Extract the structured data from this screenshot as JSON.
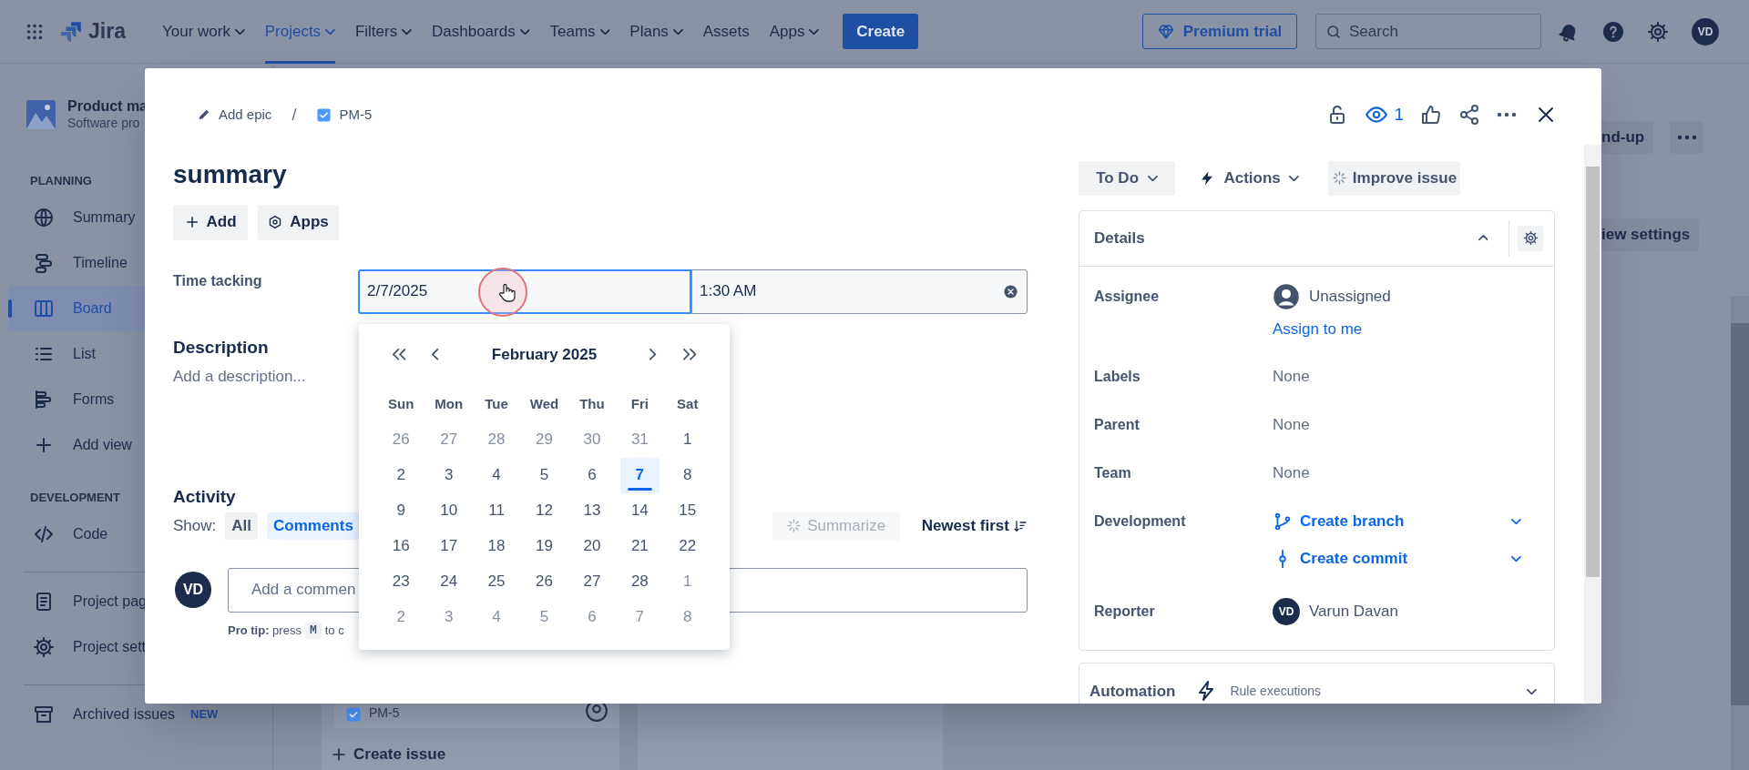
{
  "top_nav": {
    "product": "Jira",
    "items": [
      {
        "label": "Your work",
        "dropdown": true,
        "selected": false
      },
      {
        "label": "Projects",
        "dropdown": true,
        "selected": true
      },
      {
        "label": "Filters",
        "dropdown": true,
        "selected": false
      },
      {
        "label": "Dashboards",
        "dropdown": true,
        "selected": false
      },
      {
        "label": "Teams",
        "dropdown": true,
        "selected": false
      },
      {
        "label": "Plans",
        "dropdown": true,
        "selected": false
      },
      {
        "label": "Assets",
        "dropdown": false,
        "selected": false
      },
      {
        "label": "Apps",
        "dropdown": true,
        "selected": false
      }
    ],
    "create_button": "Create",
    "premium_button": "Premium trial",
    "search": {
      "placeholder": "Search"
    },
    "avatar": "VD"
  },
  "sidebar": {
    "project": {
      "name": "Product ma",
      "type": "Software pro"
    },
    "groups": [
      {
        "heading": "PLANNING",
        "items": [
          {
            "label": "Summary",
            "selected": false
          },
          {
            "label": "Timeline",
            "selected": false
          },
          {
            "label": "Board",
            "selected": true
          },
          {
            "label": "List",
            "selected": false
          },
          {
            "label": "Forms",
            "selected": false
          },
          {
            "label": "Add view",
            "selected": false
          }
        ]
      },
      {
        "heading": "DEVELOPMENT",
        "items": [
          {
            "label": "Code",
            "selected": false
          }
        ]
      },
      {
        "items": [
          {
            "label": "Project pag",
            "selected": false
          },
          {
            "label": "Project sett",
            "selected": false
          }
        ]
      },
      {
        "items": [
          {
            "label": "Archived issues",
            "badge": "NEW",
            "selected": false
          }
        ]
      }
    ]
  },
  "board": {
    "header_button": "nd-up",
    "view_settings": "iew settings",
    "card": {
      "key": "PM-5"
    },
    "create_issue": "Create issue"
  },
  "issue_modal": {
    "breadcrumb": {
      "epic": "Add epic",
      "separator": "/",
      "issue_key": "PM-5"
    },
    "watch_count": "1",
    "title": "summary",
    "quick_buttons": [
      "Add",
      "Apps"
    ],
    "time_tracking": {
      "label": "Time tacking",
      "date": "2/7/2025",
      "time": "1:30 AM"
    },
    "calendar": {
      "month": "February 2025",
      "weekdays": [
        "Sun",
        "Mon",
        "Tue",
        "Wed",
        "Thu",
        "Fri",
        "Sat"
      ],
      "weeks": [
        [
          {
            "day": "26",
            "outside": true,
            "selected": false
          },
          {
            "day": "27",
            "outside": true,
            "selected": false
          },
          {
            "day": "28",
            "outside": true,
            "selected": false
          },
          {
            "day": "29",
            "outside": true,
            "selected": false
          },
          {
            "day": "30",
            "outside": true,
            "selected": false
          },
          {
            "day": "31",
            "outside": true,
            "selected": false
          },
          {
            "day": "1",
            "outside": false,
            "selected": false
          }
        ],
        [
          {
            "day": "2",
            "outside": false,
            "selected": false
          },
          {
            "day": "3",
            "outside": false,
            "selected": false
          },
          {
            "day": "4",
            "outside": false,
            "selected": false
          },
          {
            "day": "5",
            "outside": false,
            "selected": false
          },
          {
            "day": "6",
            "outside": false,
            "selected": false
          },
          {
            "day": "7",
            "outside": false,
            "selected": true
          },
          {
            "day": "8",
            "outside": false,
            "selected": false
          }
        ],
        [
          {
            "day": "9",
            "outside": false,
            "selected": false
          },
          {
            "day": "10",
            "outside": false,
            "selected": false
          },
          {
            "day": "11",
            "outside": false,
            "selected": false
          },
          {
            "day": "12",
            "outside": false,
            "selected": false
          },
          {
            "day": "13",
            "outside": false,
            "selected": false
          },
          {
            "day": "14",
            "outside": false,
            "selected": false
          },
          {
            "day": "15",
            "outside": false,
            "selected": false
          }
        ],
        [
          {
            "day": "16",
            "outside": false,
            "selected": false
          },
          {
            "day": "17",
            "outside": false,
            "selected": false
          },
          {
            "day": "18",
            "outside": false,
            "selected": false
          },
          {
            "day": "19",
            "outside": false,
            "selected": false
          },
          {
            "day": "20",
            "outside": false,
            "selected": false
          },
          {
            "day": "21",
            "outside": false,
            "selected": false
          },
          {
            "day": "22",
            "outside": false,
            "selected": false
          }
        ],
        [
          {
            "day": "23",
            "outside": false,
            "selected": false
          },
          {
            "day": "24",
            "outside": false,
            "selected": false
          },
          {
            "day": "25",
            "outside": false,
            "selected": false
          },
          {
            "day": "26",
            "outside": false,
            "selected": false
          },
          {
            "day": "27",
            "outside": false,
            "selected": false
          },
          {
            "day": "28",
            "outside": false,
            "selected": false
          },
          {
            "day": "1",
            "outside": true,
            "selected": false
          }
        ],
        [
          {
            "day": "2",
            "outside": true,
            "selected": false
          },
          {
            "day": "3",
            "outside": true,
            "selected": false
          },
          {
            "day": "4",
            "outside": true,
            "selected": false
          },
          {
            "day": "5",
            "outside": true,
            "selected": false
          },
          {
            "day": "6",
            "outside": true,
            "selected": false
          },
          {
            "day": "7",
            "outside": true,
            "selected": false
          },
          {
            "day": "8",
            "outside": true,
            "selected": false
          }
        ]
      ]
    },
    "description": {
      "heading": "Description",
      "placeholder": "Add a description..."
    },
    "activity": {
      "heading": "Activity",
      "show_label": "Show:",
      "filters": [
        {
          "label": "All",
          "selected": false
        },
        {
          "label": "Comments",
          "selected": true
        }
      ],
      "summarize": {
        "label": "Summarize",
        "disabled": true
      },
      "sort": "Newest first",
      "comment": {
        "avatar": "VD",
        "placeholder": "Add a commen"
      },
      "pro_tip": {
        "lead": "**Pro tip:** press",
        "key": "M",
        "rest": "to c"
      }
    },
    "status_button": "To Do",
    "actions_button": "Actions",
    "improve_button": "Improve issue",
    "details": {
      "heading": "Details",
      "expanded": true,
      "fields": [
        {
          "label": "Assignee",
          "kind": "user",
          "value": "Unassigned",
          "link": "Assign to me"
        },
        {
          "label": "Labels",
          "kind": "text",
          "value": "None"
        },
        {
          "label": "Parent",
          "kind": "text",
          "value": "None"
        },
        {
          "label": "Team",
          "kind": "text",
          "value": "None"
        },
        {
          "label": "Development",
          "kind": "dev",
          "links": [
            "Create branch",
            "Create commit"
          ]
        },
        {
          "label": "Reporter",
          "kind": "person",
          "avatar": "VD",
          "value": "Varun Davan"
        }
      ]
    },
    "automation": {
      "heading": "Automation",
      "subtitle": "Rule executions"
    }
  }
}
